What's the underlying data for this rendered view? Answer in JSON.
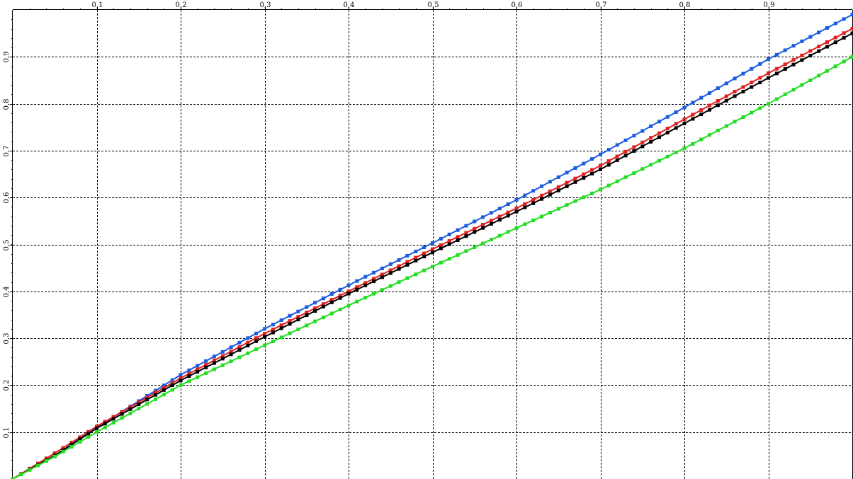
{
  "chart_data": {
    "type": "line",
    "xlim": [
      0,
      1
    ],
    "ylim": [
      0,
      1
    ],
    "x_ticks": [
      0.1,
      0.2,
      0.3,
      0.4,
      0.5,
      0.6,
      0.7,
      0.8,
      0.9
    ],
    "y_ticks": [
      0.1,
      0.2,
      0.3,
      0.4,
      0.5,
      0.6,
      0.7,
      0.8,
      0.9
    ],
    "x_tick_labels": [
      "0,1",
      "0,2",
      "0,3",
      "0,4",
      "0,5",
      "0,6",
      "0,7",
      "0,8",
      "0,9"
    ],
    "y_tick_labels": [
      "0,1",
      "0,2",
      "0,3",
      "0,4",
      "0,5",
      "0,6",
      "0,7",
      "0,8",
      "0,9"
    ],
    "grid": true,
    "x_axis_position": "top",
    "y_axis_position": "left",
    "markers": "filled squares",
    "series": [
      {
        "color": "#1a5ce0",
        "x": [
          0,
          0.05,
          0.1,
          0.2,
          0.3,
          0.4,
          0.5,
          0.6,
          0.7,
          0.8,
          0.9,
          1.0
        ],
        "values": [
          0,
          0.05,
          0.11,
          0.222,
          0.32,
          0.413,
          0.503,
          0.595,
          0.692,
          0.792,
          0.895,
          0.99
        ]
      },
      {
        "color": "#e02020",
        "x": [
          0,
          0.05,
          0.1,
          0.2,
          0.3,
          0.4,
          0.5,
          0.6,
          0.7,
          0.8,
          0.9,
          1.0
        ],
        "values": [
          0,
          0.055,
          0.112,
          0.215,
          0.31,
          0.4,
          0.49,
          0.577,
          0.668,
          0.767,
          0.865,
          0.96
        ]
      },
      {
        "color": "#000000",
        "x": [
          0,
          0.05,
          0.1,
          0.2,
          0.3,
          0.4,
          0.5,
          0.6,
          0.7,
          0.8,
          0.9,
          1.0
        ],
        "values": [
          0,
          0.05,
          0.108,
          0.21,
          0.303,
          0.395,
          0.483,
          0.57,
          0.66,
          0.758,
          0.855,
          0.95
        ]
      },
      {
        "color": "#22dd22",
        "x": [
          0,
          0.05,
          0.1,
          0.2,
          0.3,
          0.4,
          0.5,
          0.6,
          0.7,
          0.8,
          0.9,
          1.0
        ],
        "values": [
          0,
          0.048,
          0.1,
          0.2,
          0.285,
          0.37,
          0.453,
          0.535,
          0.617,
          0.705,
          0.8,
          0.9
        ]
      }
    ]
  }
}
